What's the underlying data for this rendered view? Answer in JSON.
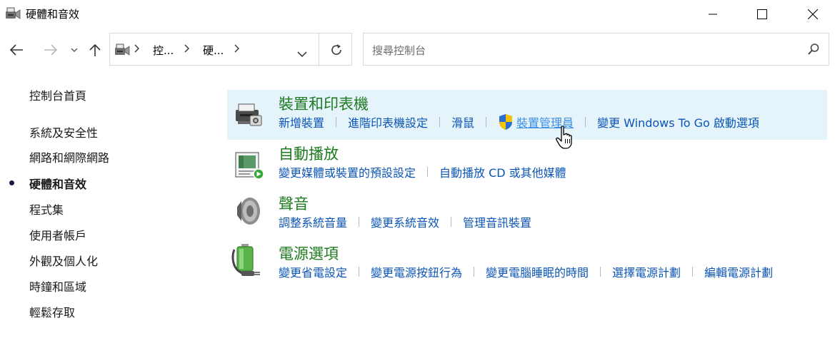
{
  "window": {
    "title": "硬體和音效",
    "icon": "hardware-sound-icon",
    "controls": [
      "minimize-icon",
      "maximize-icon",
      "close-icon"
    ]
  },
  "nav": {
    "back_icon": "arrow-left-icon",
    "forward_icon": "arrow-right-icon",
    "recent_icon": "chevron-down-icon",
    "up_icon": "arrow-up-icon",
    "breadcrumb": [
      "控...",
      "硬..."
    ],
    "refresh_icon": "refresh-icon",
    "search_placeholder": "搜尋控制台"
  },
  "sidebar": {
    "items": [
      {
        "label": "控制台首頁",
        "current": false
      },
      {
        "label": "系統及安全性",
        "current": false
      },
      {
        "label": "網路和網際網路",
        "current": false
      },
      {
        "label": "硬體和音效",
        "current": true
      },
      {
        "label": "程式集",
        "current": false
      },
      {
        "label": "使用者帳戶",
        "current": false
      },
      {
        "label": "外觀及個人化",
        "current": false
      },
      {
        "label": "時鐘和區域",
        "current": false
      },
      {
        "label": "輕鬆存取",
        "current": false
      }
    ]
  },
  "categories": [
    {
      "title": "裝置和印表機",
      "icon": "printer-icon",
      "links": [
        "新增裝置",
        "進階印表機設定",
        "滑鼠",
        "裝置管理員",
        "變更 Windows To Go 啟動選項"
      ]
    },
    {
      "title": "自動播放",
      "icon": "autoplay-icon",
      "links": [
        "變更媒體或裝置的預設設定",
        "自動播放 CD 或其他媒體"
      ]
    },
    {
      "title": "聲音",
      "icon": "speaker-icon",
      "links": [
        "調整系統音量",
        "變更系統音效",
        "管理音訊裝置"
      ]
    },
    {
      "title": "電源選項",
      "icon": "battery-icon",
      "links": [
        "變更省電設定",
        "變更電源按鈕行為",
        "變更電腦睡眠的時間",
        "選擇電源計劃",
        "編輯電源計劃"
      ]
    }
  ],
  "colors": {
    "category_title": "#1e7a1e",
    "link": "#0b55b5",
    "hover_bg": "#e5f3fb"
  }
}
